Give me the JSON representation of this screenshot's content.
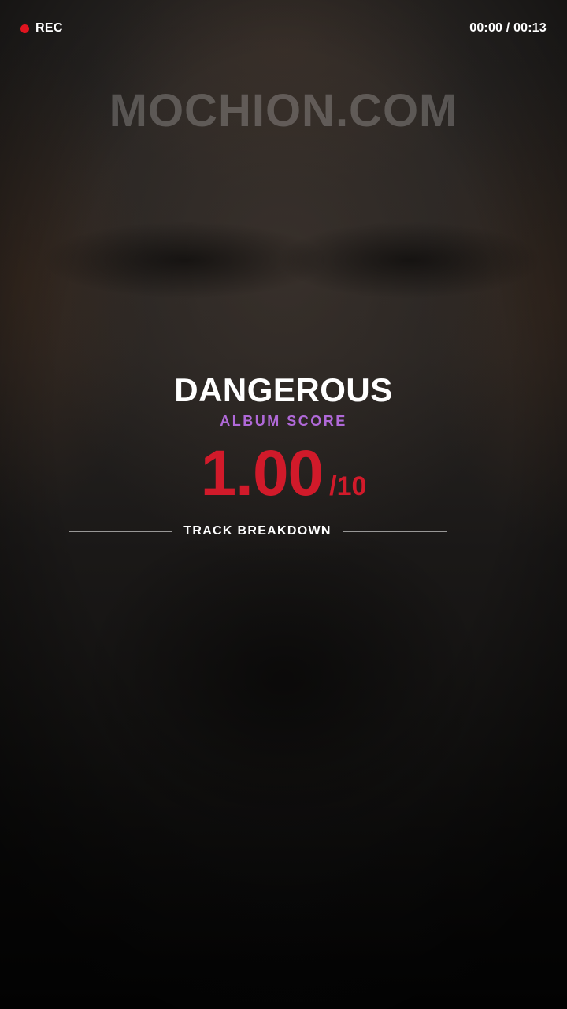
{
  "status_bar": {
    "rec_label": "REC",
    "timer": "00:00 / 00:13",
    "rec_color": "#e0141f"
  },
  "watermark": {
    "text": "MOCHION.COM"
  },
  "album": {
    "title": "DANGEROUS",
    "score_label": "ALBUM SCORE",
    "score": "1.00",
    "score_max": "/10",
    "score_color": "#d11a2a",
    "label_color": "#b069d8"
  },
  "section": {
    "breakdown_label": "TRACK BREAKDOWN"
  }
}
